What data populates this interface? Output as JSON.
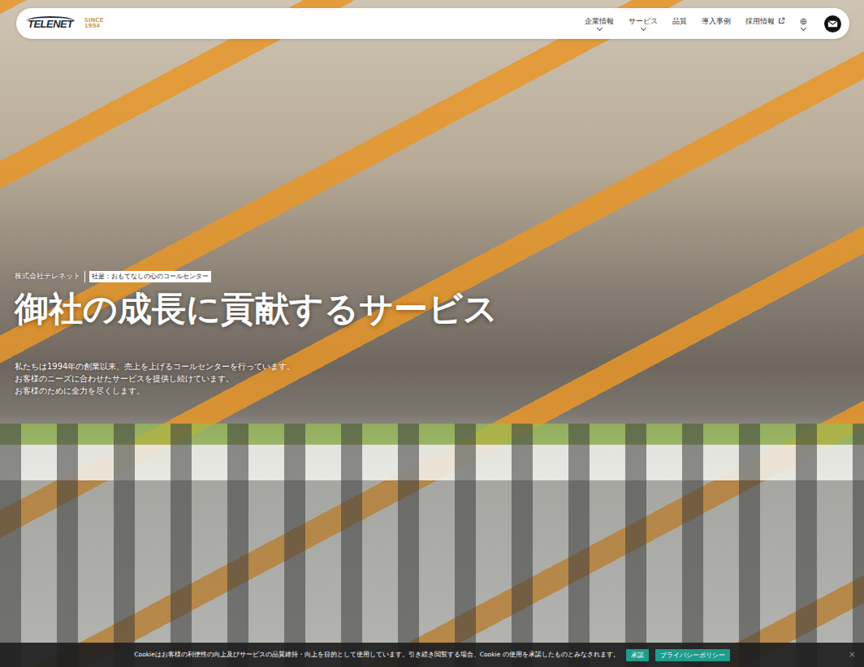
{
  "header": {
    "logo": {
      "name": "TELENET",
      "since": "SINCE",
      "year": "1994"
    },
    "nav": [
      {
        "label": "企業情報",
        "dropdown": true,
        "external": false
      },
      {
        "label": "サービス",
        "dropdown": true,
        "external": false
      },
      {
        "label": "品質",
        "dropdown": false,
        "external": false
      },
      {
        "label": "導入事例",
        "dropdown": false,
        "external": false
      },
      {
        "label": "採用情報",
        "dropdown": false,
        "external": true
      }
    ],
    "language": {
      "dropdown": true
    }
  },
  "hero": {
    "company": "株式会社テレネット",
    "motto": "社是：おもてなしの心のコールセンター",
    "heading": "御社の成長に貢献するサービス",
    "lines": [
      "私たちは1994年の創業以来、売上を上げるコールセンターを行っています。",
      "お客様のニーズに合わせたサービスを提供し続けています。",
      "お客様のために全力を尽くします。"
    ]
  },
  "cookie_bar": {
    "text": "Cookieはお客様の利便性の向上及びサービスの品質維持・向上を目的として使用しています。引き続き閲覧する場合、Cookie の使用を承諾したものとみなされます。",
    "buttons": [
      "承諾",
      "プライバシーポリシー"
    ],
    "close": "×"
  }
}
